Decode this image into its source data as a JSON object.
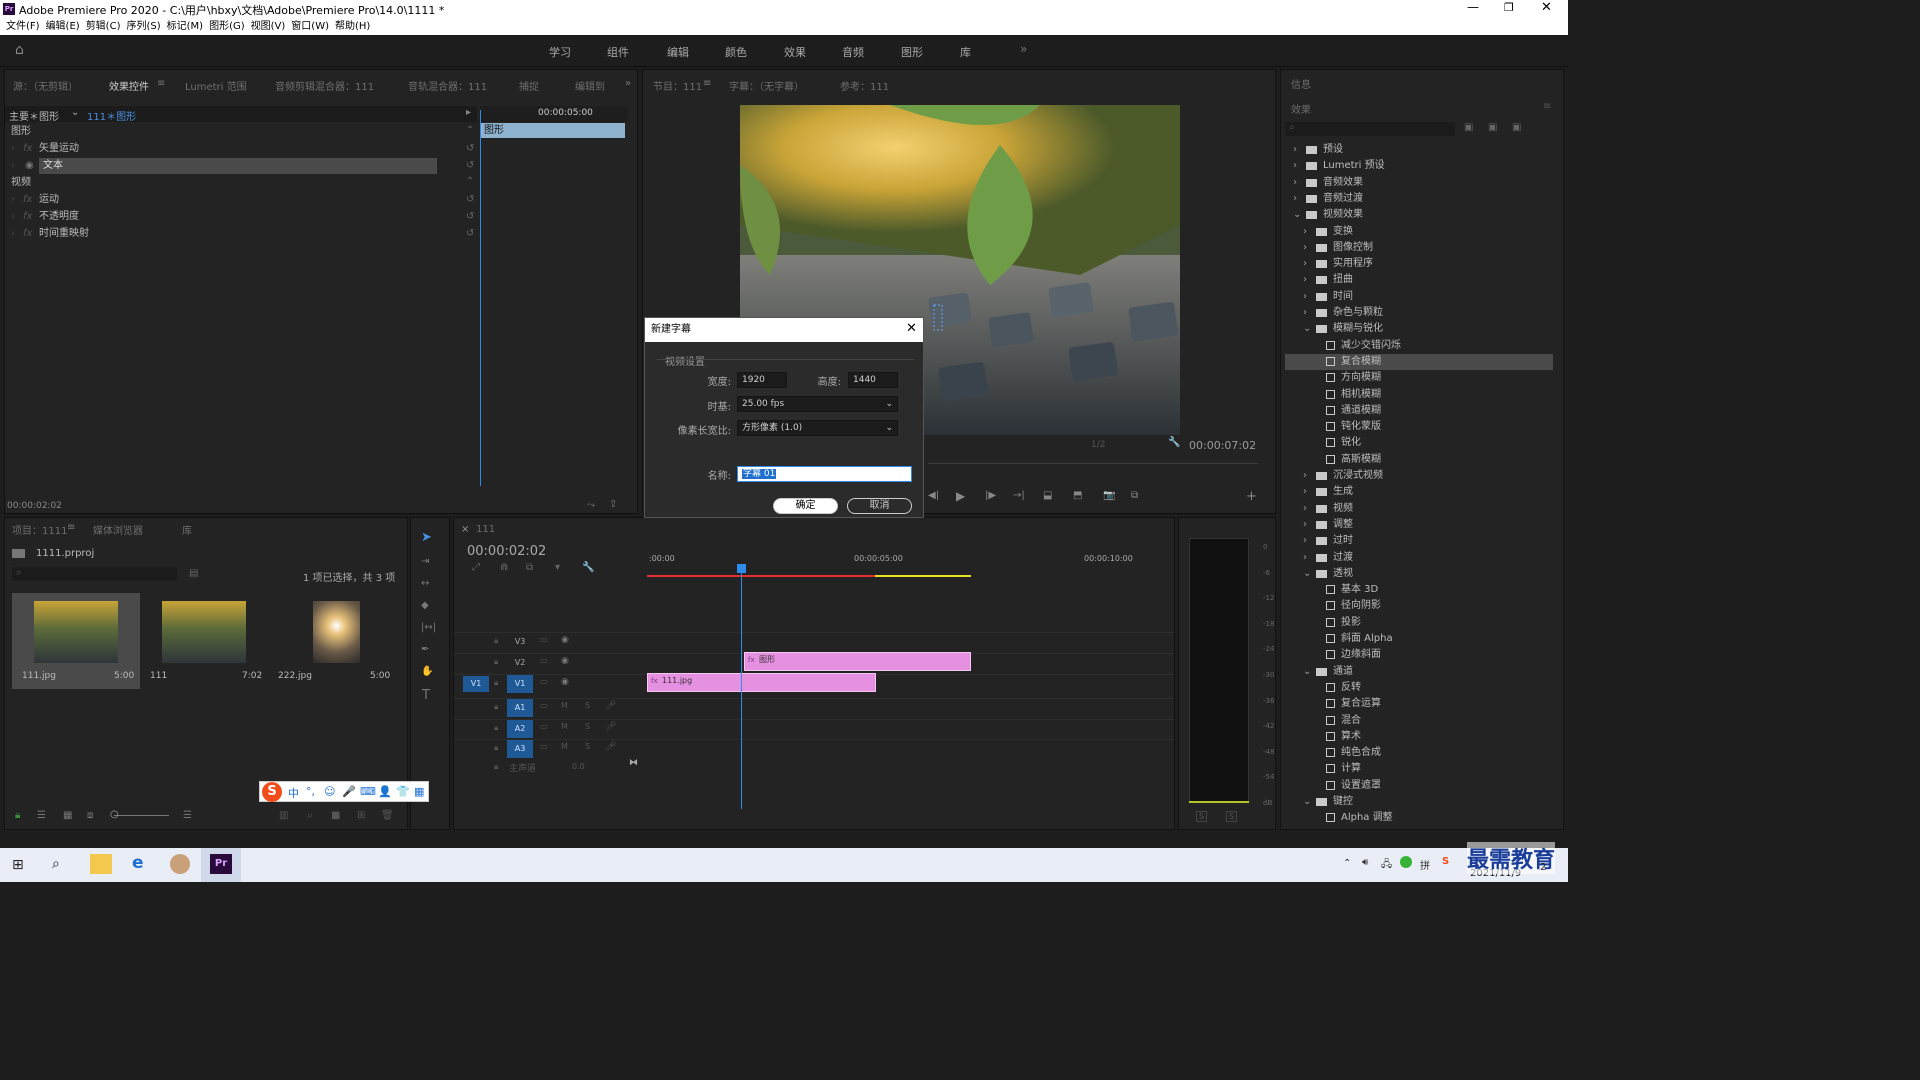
{
  "window": {
    "title": "Adobe Premiere Pro 2020 - C:\\用户\\hbxy\\文档\\Adobe\\Premiere Pro\\14.0\\1111 *",
    "app_icon": "Pr"
  },
  "menu": [
    "文件(F)",
    "编辑(E)",
    "剪辑(C)",
    "序列(S)",
    "标记(M)",
    "图形(G)",
    "视图(V)",
    "窗口(W)",
    "帮助(H)"
  ],
  "workspaces": [
    "学习",
    "组件",
    "编辑",
    "颜色",
    "效果",
    "音频",
    "图形",
    "库"
  ],
  "source_panel": {
    "tabs": [
      "源：（无剪辑）",
      "效果控件",
      "Lumetri 范围",
      "音频剪辑混合器：111",
      "音轨混合器：111",
      "捕捉",
      "编辑到"
    ],
    "header_master": "主要＊图形",
    "header_clip": "111＊图形",
    "ruler_time": "00:00:05:00",
    "clip_name": "图形",
    "sections": [
      {
        "label": "图形",
        "type": "header"
      },
      {
        "label": "矢量运动",
        "type": "fx"
      },
      {
        "label": "文本",
        "type": "fx-selected"
      },
      {
        "label": "视频",
        "type": "header"
      },
      {
        "label": "运动",
        "type": "fx"
      },
      {
        "label": "不透明度",
        "type": "fx"
      },
      {
        "label": "时间重映射",
        "type": "fx"
      }
    ],
    "timecode": "00:00:02:02"
  },
  "program_panel": {
    "tabs": [
      "节目：111",
      "字幕：（无字幕）",
      "参考：111"
    ],
    "timecode": "00:00:07:02",
    "fit": "1/2"
  },
  "project_panel": {
    "tabs": [
      "项目：1111",
      "媒体浏览器",
      "库"
    ],
    "project_file": "1111.prproj",
    "selection_info": "1 项已选择，共 3 项",
    "items": [
      {
        "name": "111.jpg",
        "duration": "5:00"
      },
      {
        "name": "111",
        "duration": "7:02"
      },
      {
        "name": "222.jpg",
        "duration": "5:00"
      }
    ]
  },
  "timeline": {
    "tab": "111",
    "timecode": "00:00:02:02",
    "ruler": [
      ":00:00",
      "00:00:05:00",
      "00:00:10:00"
    ],
    "tracks": [
      "V3",
      "V2",
      "V1",
      "A1",
      "A2",
      "A3"
    ],
    "master": "主声道",
    "master_value": "0.0",
    "clips": [
      {
        "name": "图形",
        "track": "V2"
      },
      {
        "name": "111.jpg",
        "track": "V1"
      }
    ]
  },
  "meter": {
    "scale": [
      "0",
      "-6",
      "-12",
      "-18",
      "-24",
      "-30",
      "-36",
      "-42",
      "-48",
      "-54",
      "dB"
    ]
  },
  "effects_panel": {
    "tabs": [
      "信息"
    ],
    "title": "效果",
    "tree": [
      {
        "label": "预设",
        "level": 0,
        "open": false,
        "kind": "folder"
      },
      {
        "label": "Lumetri 预设",
        "level": 0,
        "open": false,
        "kind": "folder"
      },
      {
        "label": "音频效果",
        "level": 0,
        "open": false,
        "kind": "folder"
      },
      {
        "label": "音频过渡",
        "level": 0,
        "open": false,
        "kind": "folder"
      },
      {
        "label": "视频效果",
        "level": 0,
        "open": true,
        "kind": "folder"
      },
      {
        "label": "变换",
        "level": 1,
        "open": false,
        "kind": "folder"
      },
      {
        "label": "图像控制",
        "level": 1,
        "open": false,
        "kind": "folder"
      },
      {
        "label": "实用程序",
        "level": 1,
        "open": false,
        "kind": "folder"
      },
      {
        "label": "扭曲",
        "level": 1,
        "open": false,
        "kind": "folder"
      },
      {
        "label": "时间",
        "level": 1,
        "open": false,
        "kind": "folder"
      },
      {
        "label": "杂色与颗粒",
        "level": 1,
        "open": false,
        "kind": "folder"
      },
      {
        "label": "模糊与锐化",
        "level": 1,
        "open": true,
        "kind": "folder"
      },
      {
        "label": "减少交错闪烁",
        "level": 2,
        "kind": "fx"
      },
      {
        "label": "复合模糊",
        "level": 2,
        "kind": "fx",
        "selected": true
      },
      {
        "label": "方向模糊",
        "level": 2,
        "kind": "fx"
      },
      {
        "label": "相机模糊",
        "level": 2,
        "kind": "fx"
      },
      {
        "label": "通道模糊",
        "level": 2,
        "kind": "fx"
      },
      {
        "label": "钝化蒙版",
        "level": 2,
        "kind": "fx"
      },
      {
        "label": "锐化",
        "level": 2,
        "kind": "fx"
      },
      {
        "label": "高斯模糊",
        "level": 2,
        "kind": "fx"
      },
      {
        "label": "沉浸式视频",
        "level": 1,
        "open": false,
        "kind": "folder"
      },
      {
        "label": "生成",
        "level": 1,
        "open": false,
        "kind": "folder"
      },
      {
        "label": "视频",
        "level": 1,
        "open": false,
        "kind": "folder"
      },
      {
        "label": "调整",
        "level": 1,
        "open": false,
        "kind": "folder"
      },
      {
        "label": "过时",
        "level": 1,
        "open": false,
        "kind": "folder"
      },
      {
        "label": "过渡",
        "level": 1,
        "open": false,
        "kind": "folder"
      },
      {
        "label": "透视",
        "level": 1,
        "open": true,
        "kind": "folder"
      },
      {
        "label": "基本 3D",
        "level": 2,
        "kind": "fx"
      },
      {
        "label": "径向阴影",
        "level": 2,
        "kind": "fx"
      },
      {
        "label": "投影",
        "level": 2,
        "kind": "fx"
      },
      {
        "label": "斜面 Alpha",
        "level": 2,
        "kind": "fx"
      },
      {
        "label": "边缘斜面",
        "level": 2,
        "kind": "fx"
      },
      {
        "label": "通道",
        "level": 1,
        "open": true,
        "kind": "folder"
      },
      {
        "label": "反转",
        "level": 2,
        "kind": "fx"
      },
      {
        "label": "复合运算",
        "level": 2,
        "kind": "fx"
      },
      {
        "label": "混合",
        "level": 2,
        "kind": "fx"
      },
      {
        "label": "算术",
        "level": 2,
        "kind": "fx"
      },
      {
        "label": "纯色合成",
        "level": 2,
        "kind": "fx"
      },
      {
        "label": "计算",
        "level": 2,
        "kind": "fx"
      },
      {
        "label": "设置遮罩",
        "level": 2,
        "kind": "fx"
      },
      {
        "label": "键控",
        "level": 1,
        "open": true,
        "kind": "folder"
      },
      {
        "label": "Alpha 调整",
        "level": 2,
        "kind": "fx"
      }
    ]
  },
  "dialog": {
    "title": "新建字幕",
    "group": "视频设置",
    "width_label": "宽度:",
    "width": "1920",
    "height_label": "高度:",
    "height": "1440",
    "timebase_label": "时基:",
    "timebase": "25.00 fps",
    "par_label": "像素长宽比:",
    "par": "方形像素 (1.0)",
    "name_label": "名称:",
    "name": "字幕 01",
    "ok": "确定",
    "cancel": "取消"
  },
  "ime_toolbar": [
    "中",
    "°,",
    "☺",
    "🎤",
    "⌨",
    "👤",
    "👕",
    "▦"
  ],
  "taskbar": {
    "date": "2021/11/9",
    "watermark": "最需教育",
    "badge": "2"
  },
  "colors": {
    "accent": "#2d8ceb",
    "clip": "#e590e0",
    "playhead": "#2d8ceb",
    "workarea": "#e8df20",
    "inout": "#e23030"
  }
}
